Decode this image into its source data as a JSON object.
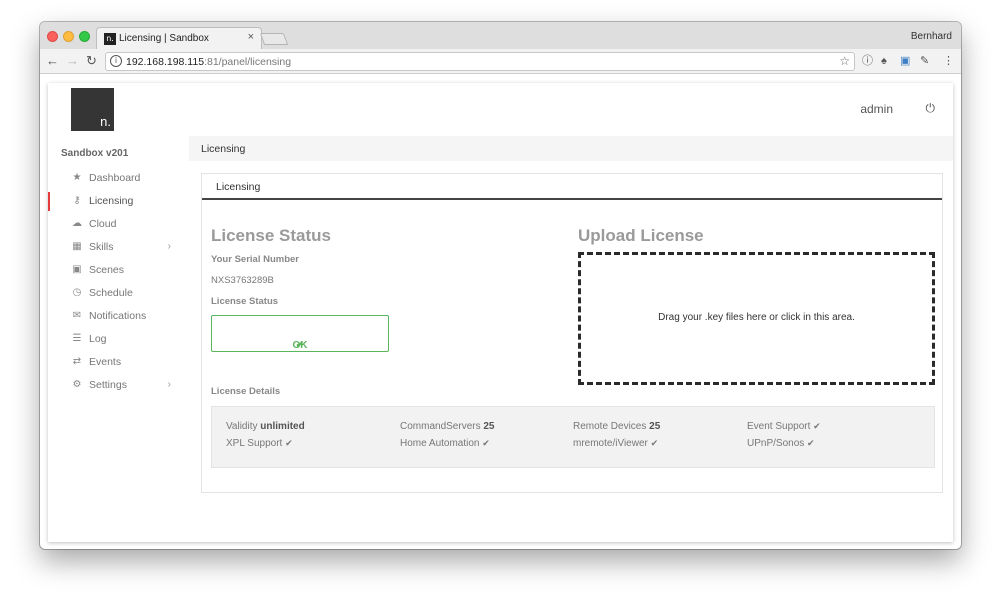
{
  "browser": {
    "tab_title": "Licensing | Sandbox",
    "favicon_text": "n.",
    "tab_close": "×",
    "profile_name": "Bernhard",
    "url_host": "192.168.198.115",
    "url_path": ":81/panel/licensing"
  },
  "app": {
    "logo_text": "n.",
    "brand": "Sandbox v201",
    "user": "admin",
    "breadcrumb": "Licensing"
  },
  "sidebar": {
    "items": [
      {
        "label": "Dashboard",
        "icon": "★"
      },
      {
        "label": "Licensing",
        "icon": "⚷"
      },
      {
        "label": "Cloud",
        "icon": "☁"
      },
      {
        "label": "Skills",
        "icon": "▦",
        "chevron": "›"
      },
      {
        "label": "Scenes",
        "icon": "▣"
      },
      {
        "label": "Schedule",
        "icon": "◷"
      },
      {
        "label": "Notifications",
        "icon": "✉"
      },
      {
        "label": "Log",
        "icon": "☰"
      },
      {
        "label": "Events",
        "icon": "⇄"
      },
      {
        "label": "Settings",
        "icon": "⚙",
        "chevron": "›"
      }
    ]
  },
  "card": {
    "header": "Licensing",
    "license_status_title": "License Status",
    "serial_label": "Your Serial Number",
    "serial_value": "NXS3763289B",
    "status_label": "License Status",
    "status_value": "OK",
    "upload_title": "Upload License",
    "dropzone_text": "Drag your .key files here or click in this area.",
    "details_label": "License Details",
    "details": [
      {
        "name": "Validity",
        "value": "unlimited"
      },
      {
        "name": "CommandServers",
        "value": "25"
      },
      {
        "name": "Remote Devices",
        "value": "25"
      },
      {
        "name": "Event Support",
        "value": ""
      },
      {
        "name": "XPL Support",
        "value": ""
      },
      {
        "name": "Home Automation",
        "value": ""
      },
      {
        "name": "mremote/iViewer",
        "value": ""
      },
      {
        "name": "UPnP/Sonos",
        "value": ""
      }
    ]
  },
  "colors": {
    "active_indicator": "#e33b3b",
    "ok_green": "#59b45c",
    "logo_bg": "#353535"
  }
}
